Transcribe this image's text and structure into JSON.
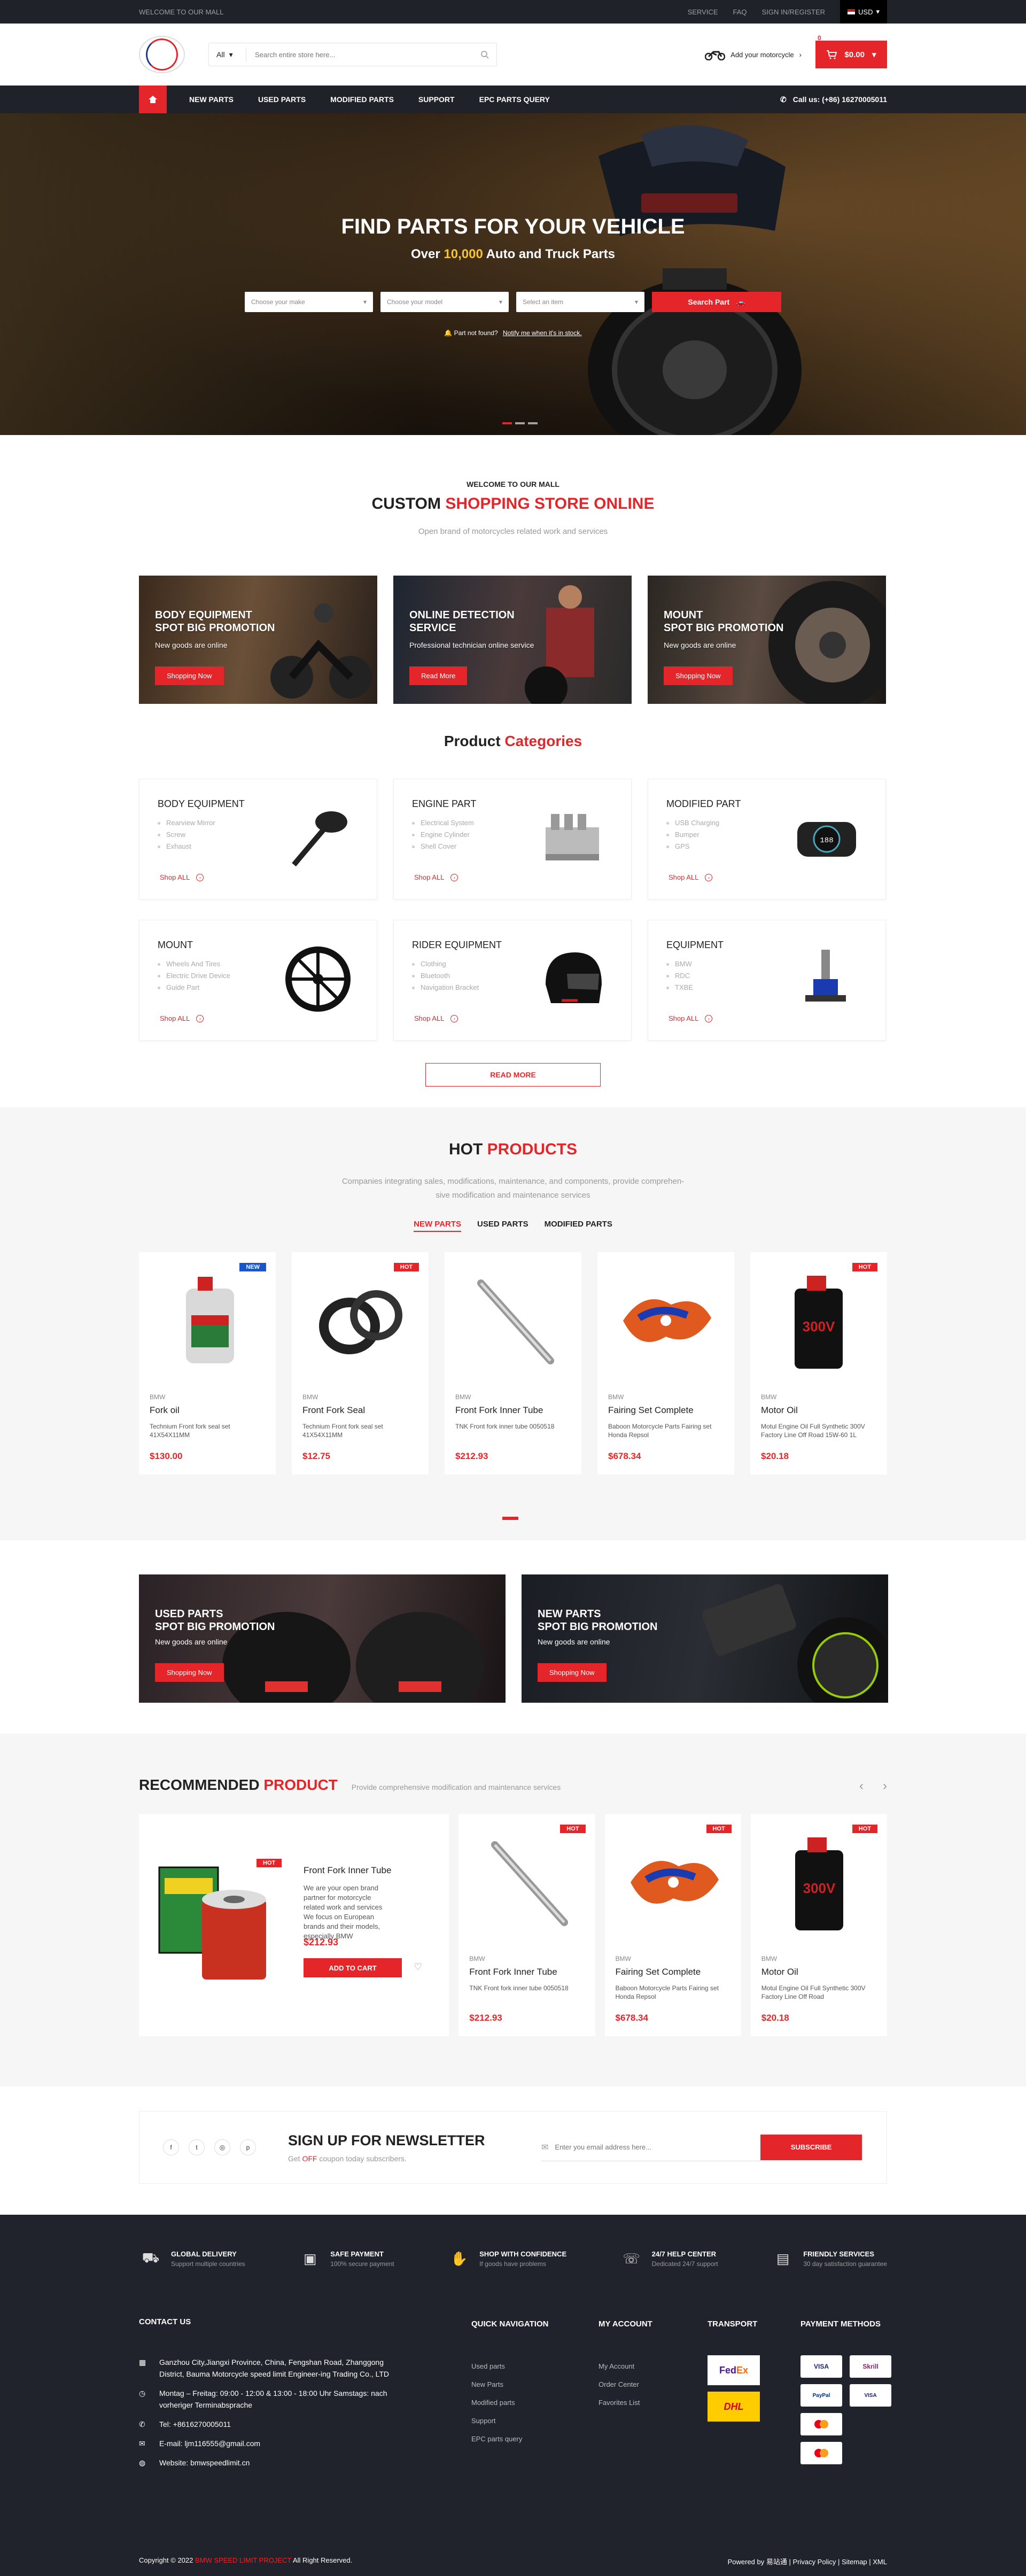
{
  "topbar": {
    "welcome": "WELCOME TO OUR MALL",
    "links": [
      "SERVICE",
      "FAQ",
      "SIGN IN/REGISTER"
    ],
    "currency": "USD"
  },
  "header": {
    "search_cat": "All",
    "search_placeholder": "Search entire store here...",
    "add_moto": "Add your motorcycle",
    "cart_count": "0",
    "cart_total": "$0.00"
  },
  "nav": {
    "items": [
      "NEW PARTS",
      "USED PARTS",
      "MODIFIED PARTS",
      "SUPPORT",
      "EPC PARTS QUERY"
    ],
    "call": "Call us: (+86) 16270005011"
  },
  "hero": {
    "title": "FIND PARTS FOR YOUR VEHICLE",
    "sub_pre": "Over",
    "sub_num": "10,000",
    "sub_post": "Auto and Truck Parts",
    "make": "Choose your make",
    "model": "Choose your model",
    "item": "Select an item",
    "search": "Search Part",
    "nf_text": "Part not found?",
    "nf_link": "Notify me when it's in stock."
  },
  "welcome": {
    "small": "WELCOME TO OUR MALL",
    "title_a": "CUSTOM ",
    "title_b": "SHOPPING STORE ONLINE",
    "desc": "Open brand of motorcycles related work and services"
  },
  "banners": [
    {
      "t1": "BODY EQUIPMENT",
      "t2": "SPOT BIG PROMOTION",
      "sub": "New goods are online",
      "btn": "Shopping Now"
    },
    {
      "t1": "ONLINE DETECTION",
      "t2": "SERVICE",
      "sub": "Professional technician online service",
      "btn": "Read More"
    },
    {
      "t1": "MOUNT",
      "t2": "SPOT BIG PROMOTION",
      "sub": "New goods are online",
      "btn": "Shopping Now"
    }
  ],
  "categories": {
    "title_a": "Product ",
    "title_b": "Categories",
    "shop_all": "Shop ALL",
    "read_more": "READ MORE",
    "items": [
      {
        "name": "BODY EQUIPMENT",
        "list": [
          "Rearview Mirror",
          "Screw",
          "Exhaust"
        ],
        "icon": "mirror-icon"
      },
      {
        "name": "ENGINE PART",
        "list": [
          "Electrical System",
          "Engine Cylinder",
          "Shell Cover"
        ],
        "icon": "engine-icon"
      },
      {
        "name": "MODIFIED PART",
        "list": [
          "USB Charging",
          "Bumper",
          "GPS"
        ],
        "icon": "gauge-icon"
      },
      {
        "name": "MOUNT",
        "list": [
          "Wheels And Tires",
          "Electric Drive Device",
          "Guide Part"
        ],
        "icon": "wheel-icon"
      },
      {
        "name": "RIDER EQUIPMENT",
        "list": [
          "Clothing",
          "Bluetooth",
          "Navigation Bracket"
        ],
        "icon": "helmet-icon"
      },
      {
        "name": "EQUIPMENT",
        "list": [
          "BMW",
          "RDC",
          "TXBE"
        ],
        "icon": "tool-icon"
      }
    ]
  },
  "hot": {
    "title_a": "HOT ",
    "title_b": "PRODUCTS",
    "desc1": "Companies integrating sales, modifications, maintenance, and components, provide comprehen-",
    "desc2": "sive modification and maintenance services",
    "tabs": [
      "NEW PARTS",
      "USED PARTS",
      "MODIFIED PARTS"
    ],
    "products": [
      {
        "tag": "NEW",
        "brand": "BMW",
        "name": "Fork oil",
        "desc": "Technium Front fork seal set 41X54X11MM",
        "price": "$130.00",
        "img": "oil-bottle"
      },
      {
        "tag": "HOT",
        "brand": "BMW",
        "name": "Front Fork Seal",
        "desc": "Technium Front fork seal set 41X54X11MM",
        "price": "$12.75",
        "img": "seal"
      },
      {
        "tag": "",
        "brand": "BMW",
        "name": "Front Fork Inner Tube",
        "desc": "TNK Front fork inner tube 0050518",
        "price": "$212.93",
        "img": "tube"
      },
      {
        "tag": "",
        "brand": "BMW",
        "name": "Fairing Set Complete",
        "desc": "Baboon Motorcycle Parts Fairing set Honda Repsol",
        "price": "$678.34",
        "img": "fairing"
      },
      {
        "tag": "HOT",
        "brand": "BMW",
        "name": "Motor Oil",
        "desc": "Motul Engine Oil Full Synthetic 300V Factory Line Off Road 15W-60 1L",
        "price": "$20.18",
        "img": "motor-oil"
      }
    ]
  },
  "promo2": [
    {
      "t1": "USED PARTS",
      "t2": "SPOT BIG PROMOTION",
      "sub": "New goods are online",
      "btn": "Shopping Now"
    },
    {
      "t1": "NEW PARTS",
      "t2": "SPOT BIG PROMOTION",
      "sub": "New goods are online",
      "btn": "Shopping Now"
    }
  ],
  "rec": {
    "title_a": "RECOMMENDED ",
    "title_b": "PRODUCT",
    "desc": "Provide comprehensive modification and maintenance services",
    "big": {
      "tag": "HOT",
      "name": "Front Fork Inner Tube",
      "desc": "We are your open brand partner for motorcycle related work and services We focus on European brands and their models, especially BMW",
      "price": "$212.93",
      "btn": "ADD TO CART"
    },
    "products": [
      {
        "tag": "HOT",
        "brand": "BMW",
        "name": "Front Fork Inner Tube",
        "desc": "TNK Front fork inner tube 0050518",
        "price": "$212.93",
        "img": "tube"
      },
      {
        "tag": "HOT",
        "brand": "BMW",
        "name": "Fairing Set Complete",
        "desc": "Baboon Motorcycle Parts Fairing set Honda Repsol",
        "price": "$678.34",
        "img": "fairing"
      },
      {
        "tag": "HOT",
        "brand": "BMW",
        "name": "Motor Oil",
        "desc": "Motul Engine Oil Full Synthetic 300V Factory Line Off Road",
        "price": "$20.18",
        "img": "motor-oil"
      }
    ]
  },
  "news": {
    "title": "SIGN UP FOR NEWSLETTER",
    "sub_a": "Get ",
    "sub_b": "OFF",
    "sub_c": " coupon today subscribers.",
    "placeholder": "Enter you email address here...",
    "btn": "SUBSCRIBE"
  },
  "feats": [
    {
      "t": "GLOBAL DELIVERY",
      "s": "Support multiple countries"
    },
    {
      "t": "SAFE PAYMENT",
      "s": "100% secure payment"
    },
    {
      "t": "SHOP WITH CONFIDENCE",
      "s": "If goods have problems"
    },
    {
      "t": "24/7 HELP CENTER",
      "s": "Dedicated 24/7 support"
    },
    {
      "t": "FRIENDLY SERVICES",
      "s": "30 day satisfaction guarantee"
    }
  ],
  "footer": {
    "contact": "CONTACT US",
    "address": "Ganzhou City,Jiangxi Province, China, Fengshan Road, Zhanggong District, Bauma Motorcycle speed limit Engineer-ing Trading Co., LTD",
    "hours": "Montag – Freitag: 09:00 - 12:00 & 13:00 - 18:00 Uhr Samstags: nach vorheriger Terminabsprache",
    "tel": "Tel: +8616270005011",
    "email": "E-mail: ljm116555@gmail.com",
    "web": "Website: bmwspeedlimit.cn",
    "quick": "QUICK NAVIGATION",
    "quick_items": [
      "Used parts",
      "New Parts",
      "Modified parts",
      "Support",
      "EPC parts query"
    ],
    "account": "MY ACCOUNT",
    "account_items": [
      "My Account",
      "Order Center",
      "Favorites List"
    ],
    "transport": "TRANSPORT",
    "payment": "PAYMENT METHODS",
    "copy_a": "Copyright © 2022 ",
    "copy_b": "BMW SPEED LIMIT PROJECT",
    "copy_c": " All Right Reserved.",
    "powered": "Powered by 易站通 | Privacy Policy | Sitemap | XML"
  }
}
